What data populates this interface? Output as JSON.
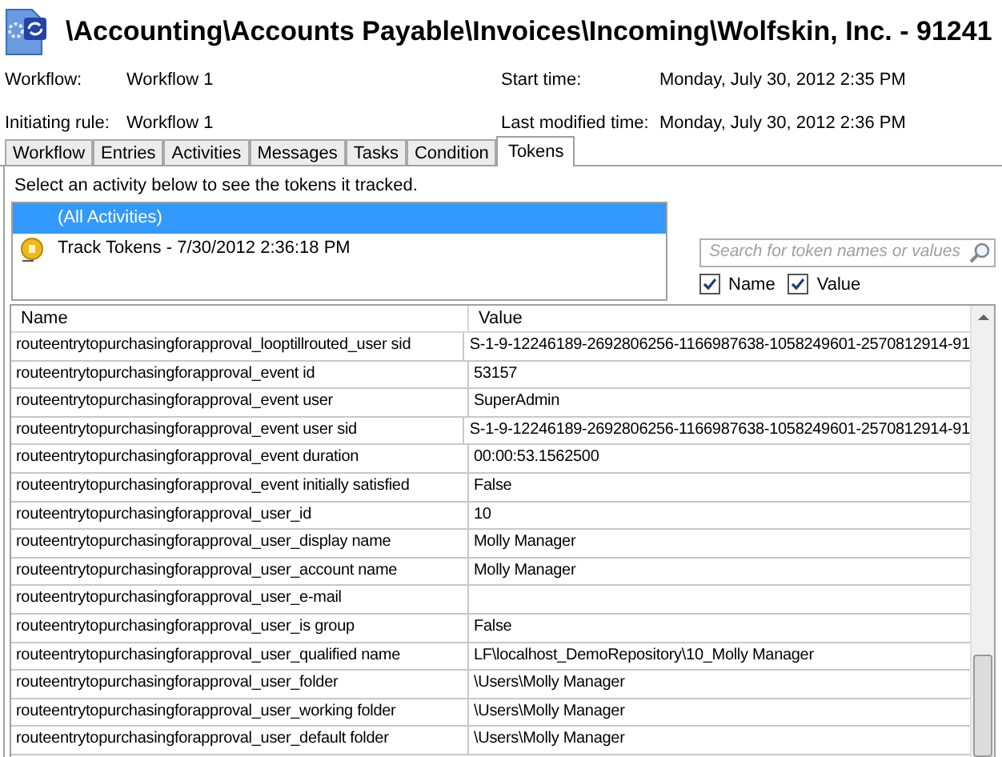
{
  "header": {
    "title": "\\Accounting\\Accounts Payable\\Invoices\\Incoming\\Wolfskin, Inc. - 91241"
  },
  "info": [
    {
      "label": "Workflow:",
      "value": "Workflow 1"
    },
    {
      "label": "Start time:",
      "value": "Monday, July 30, 2012 2:35 PM"
    },
    {
      "label": "Initiating rule:",
      "value": "Workflow 1"
    },
    {
      "label": "Last modified time:",
      "value": "Monday, July 30, 2012 2:36 PM"
    }
  ],
  "tabs": [
    {
      "label": "Workflow",
      "selected": false
    },
    {
      "label": "Entries",
      "selected": false
    },
    {
      "label": "Activities",
      "selected": false
    },
    {
      "label": "Messages",
      "selected": false
    },
    {
      "label": "Tasks",
      "selected": false
    },
    {
      "label": "Condition",
      "selected": false
    },
    {
      "label": "Tokens",
      "selected": true
    }
  ],
  "instruction": "Select an activity below to see the tokens it tracked.",
  "activities": [
    {
      "kind": "all",
      "label": "(All Activities)",
      "selected": true
    },
    {
      "kind": "activity",
      "label": "Track Tokens - 7/30/2012 2:36:18 PM",
      "selected": false
    }
  ],
  "search": {
    "placeholder": "Search for token names or values"
  },
  "filters": [
    {
      "label": "Name",
      "checked": true
    },
    {
      "label": "Value",
      "checked": true
    }
  ],
  "table": {
    "columns": [
      "Name",
      "Value"
    ],
    "rows": [
      [
        "routeentrytopurchasingforapproval_looptillrouted_user sid",
        "S-1-9-12246189-2692806256-1166987638-1058249601-2570812914-91"
      ],
      [
        "routeentrytopurchasingforapproval_event id",
        "53157"
      ],
      [
        "routeentrytopurchasingforapproval_event user",
        "SuperAdmin"
      ],
      [
        "routeentrytopurchasingforapproval_event user sid",
        "S-1-9-12246189-2692806256-1166987638-1058249601-2570812914-91"
      ],
      [
        "routeentrytopurchasingforapproval_event duration",
        "00:00:53.1562500"
      ],
      [
        "routeentrytopurchasingforapproval_event initially satisfied",
        "False"
      ],
      [
        "routeentrytopurchasingforapproval_user_id",
        "10"
      ],
      [
        "routeentrytopurchasingforapproval_user_display name",
        "Molly Manager"
      ],
      [
        "routeentrytopurchasingforapproval_user_account name",
        "Molly Manager"
      ],
      [
        "routeentrytopurchasingforapproval_user_e-mail",
        ""
      ],
      [
        "routeentrytopurchasingforapproval_user_is group",
        "False"
      ],
      [
        "routeentrytopurchasingforapproval_user_qualified name",
        "LF\\localhost_DemoRepository\\10_Molly Manager"
      ],
      [
        "routeentrytopurchasingforapproval_user_folder",
        "\\Users\\Molly Manager"
      ],
      [
        "routeentrytopurchasingforapproval_user_working folder",
        "\\Users\\Molly Manager"
      ],
      [
        "routeentrytopurchasingforapproval_user_default folder",
        "\\Users\\Molly Manager"
      ]
    ]
  }
}
